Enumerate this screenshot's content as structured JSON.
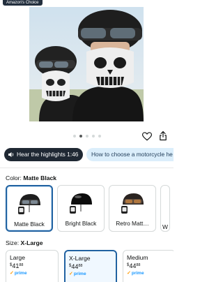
{
  "badge": {
    "label": "Amazon's Choice"
  },
  "gallery": {
    "image_count": 5,
    "active_index": 1
  },
  "actions": {
    "favorite_icon": "heart-icon",
    "share_icon": "share-icon"
  },
  "chips": {
    "highlights": {
      "icon": "speaker-icon",
      "label": "Hear the highlights 1:46"
    },
    "question": {
      "label": "How to choose a motorcycle he"
    }
  },
  "color": {
    "label": "Color:",
    "selected": "Matte Black",
    "options": [
      {
        "label": "Matte Black",
        "selected": true
      },
      {
        "label": "Bright Black",
        "selected": false
      },
      {
        "label": "Retro Matt…",
        "selected": false
      },
      {
        "label": "W",
        "selected": false
      }
    ]
  },
  "size": {
    "label": "Size:",
    "selected": "X-Large",
    "options": [
      {
        "label": "Large",
        "price_symbol": "$",
        "price_whole": "41",
        "price_cents": "88",
        "prime": "prime",
        "selected": false
      },
      {
        "label": "X-Large",
        "price_symbol": "$",
        "price_whole": "44",
        "price_cents": "88",
        "prime": "prime",
        "selected": true
      },
      {
        "label": "Medium",
        "price_symbol": "$",
        "price_whole": "44",
        "price_cents": "88",
        "prime": "prime",
        "selected": false
      }
    ]
  },
  "colors": {
    "accent": "#2162a1",
    "chip_dark": "#1f2833",
    "chip_light": "#dbeefb",
    "prime": "#1a98ff"
  }
}
